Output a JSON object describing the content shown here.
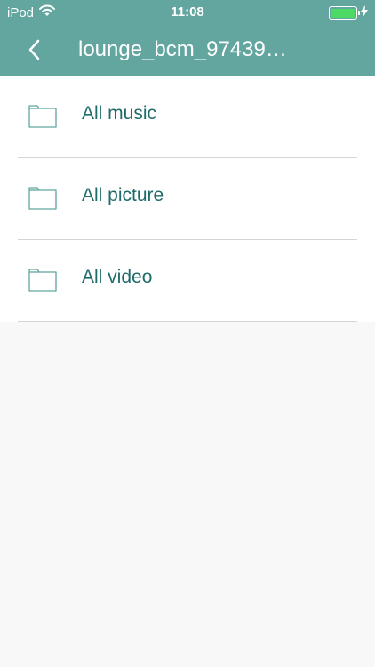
{
  "status_bar": {
    "carrier": "iPod",
    "time": "11:08"
  },
  "nav": {
    "title": "lounge_bcm_97439…",
    "back_icon": "chevron-left-icon"
  },
  "folders": [
    {
      "label": "All music",
      "icon": "folder-icon"
    },
    {
      "label": "All picture",
      "icon": "folder-icon"
    },
    {
      "label": "All video",
      "icon": "folder-icon"
    }
  ],
  "colors": {
    "header": "#62a69f",
    "label_text": "#1f6b6a",
    "battery": "#4cd964",
    "background": "#f8f8f8"
  }
}
